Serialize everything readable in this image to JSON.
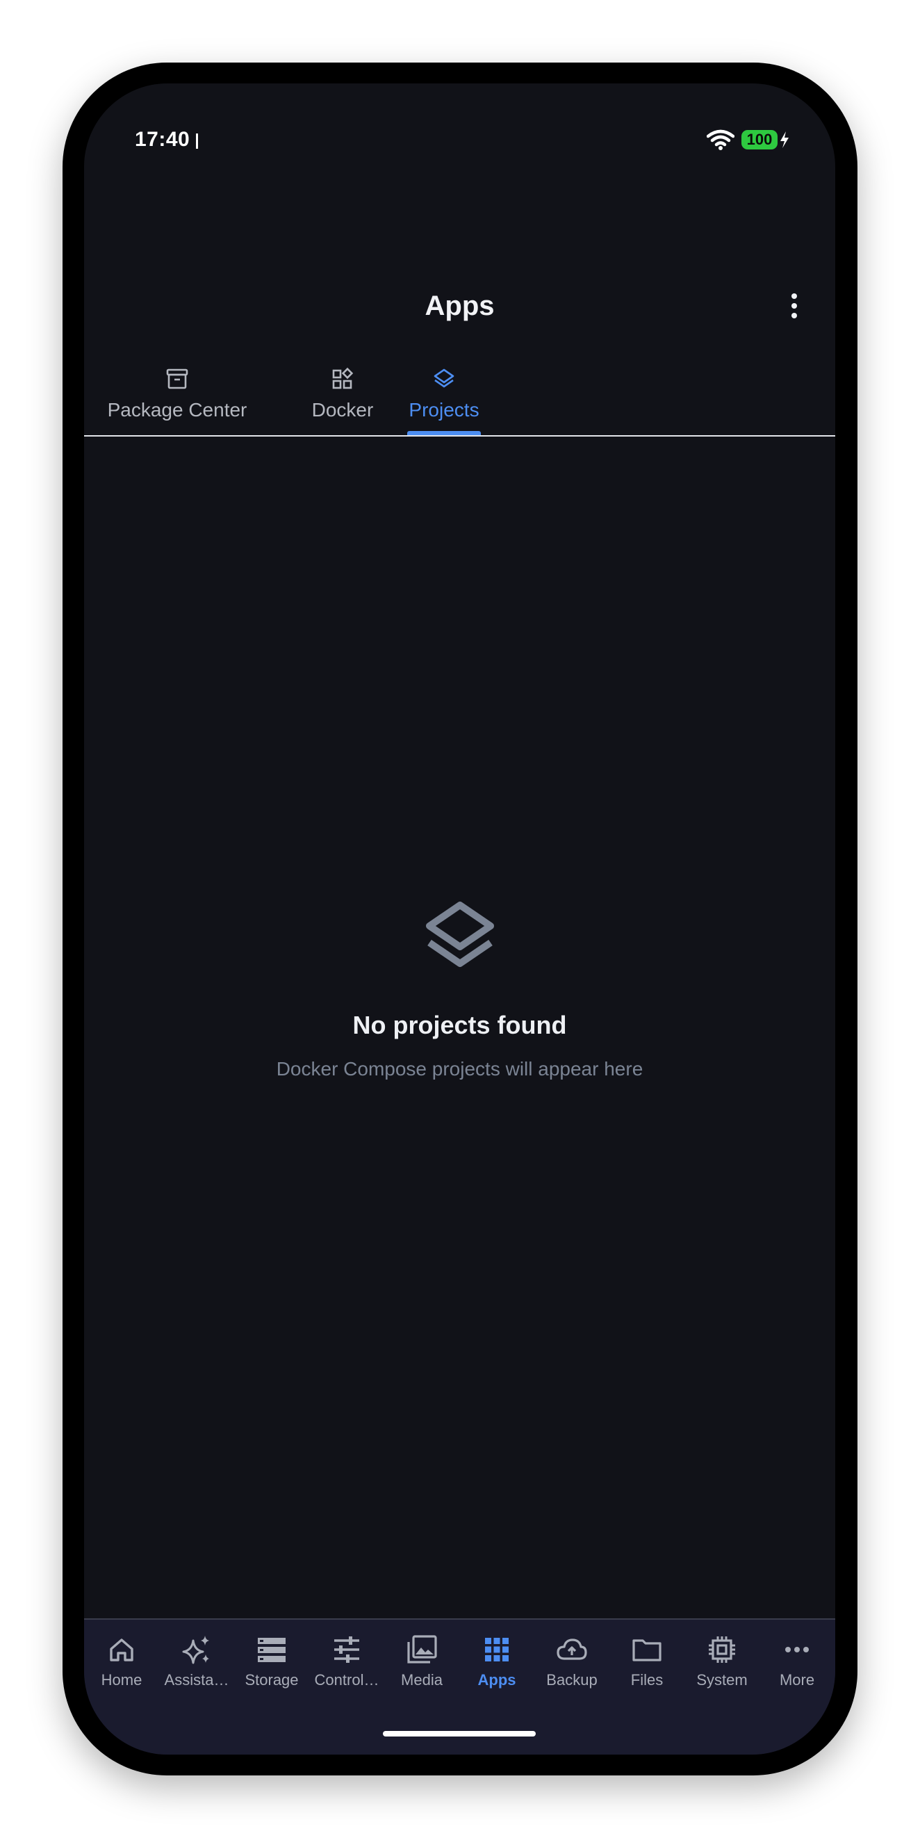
{
  "status_bar": {
    "time": "17:40",
    "battery": "100"
  },
  "header": {
    "title": "Apps"
  },
  "tabs": [
    {
      "label": "Package Center",
      "icon": "archive-box-icon",
      "active": false
    },
    {
      "label": "Docker",
      "icon": "widgets-icon",
      "active": false
    },
    {
      "label": "Projects",
      "icon": "layers-icon",
      "active": true
    }
  ],
  "empty_state": {
    "icon": "layers-icon",
    "title": "No projects found",
    "subtitle": "Docker Compose projects will appear here"
  },
  "bottom_nav": [
    {
      "label": "Home",
      "icon": "home-icon",
      "active": false
    },
    {
      "label": "Assista…",
      "icon": "sparkles-icon",
      "active": false
    },
    {
      "label": "Storage",
      "icon": "storage-icon",
      "active": false
    },
    {
      "label": "Control…",
      "icon": "sliders-icon",
      "active": false
    },
    {
      "label": "Media",
      "icon": "photo-library-icon",
      "active": false
    },
    {
      "label": "Apps",
      "icon": "grid-icon",
      "active": true
    },
    {
      "label": "Backup",
      "icon": "cloud-upload-icon",
      "active": false
    },
    {
      "label": "Files",
      "icon": "folder-icon",
      "active": false
    },
    {
      "label": "System",
      "icon": "chip-icon",
      "active": false
    },
    {
      "label": "More",
      "icon": "more-horizontal-icon",
      "active": false
    }
  ],
  "colors": {
    "background": "#111218",
    "accent": "#4d8ef2",
    "nav_background": "#1a1b2e",
    "muted_text": "#7b8494",
    "battery": "#2ec940"
  }
}
